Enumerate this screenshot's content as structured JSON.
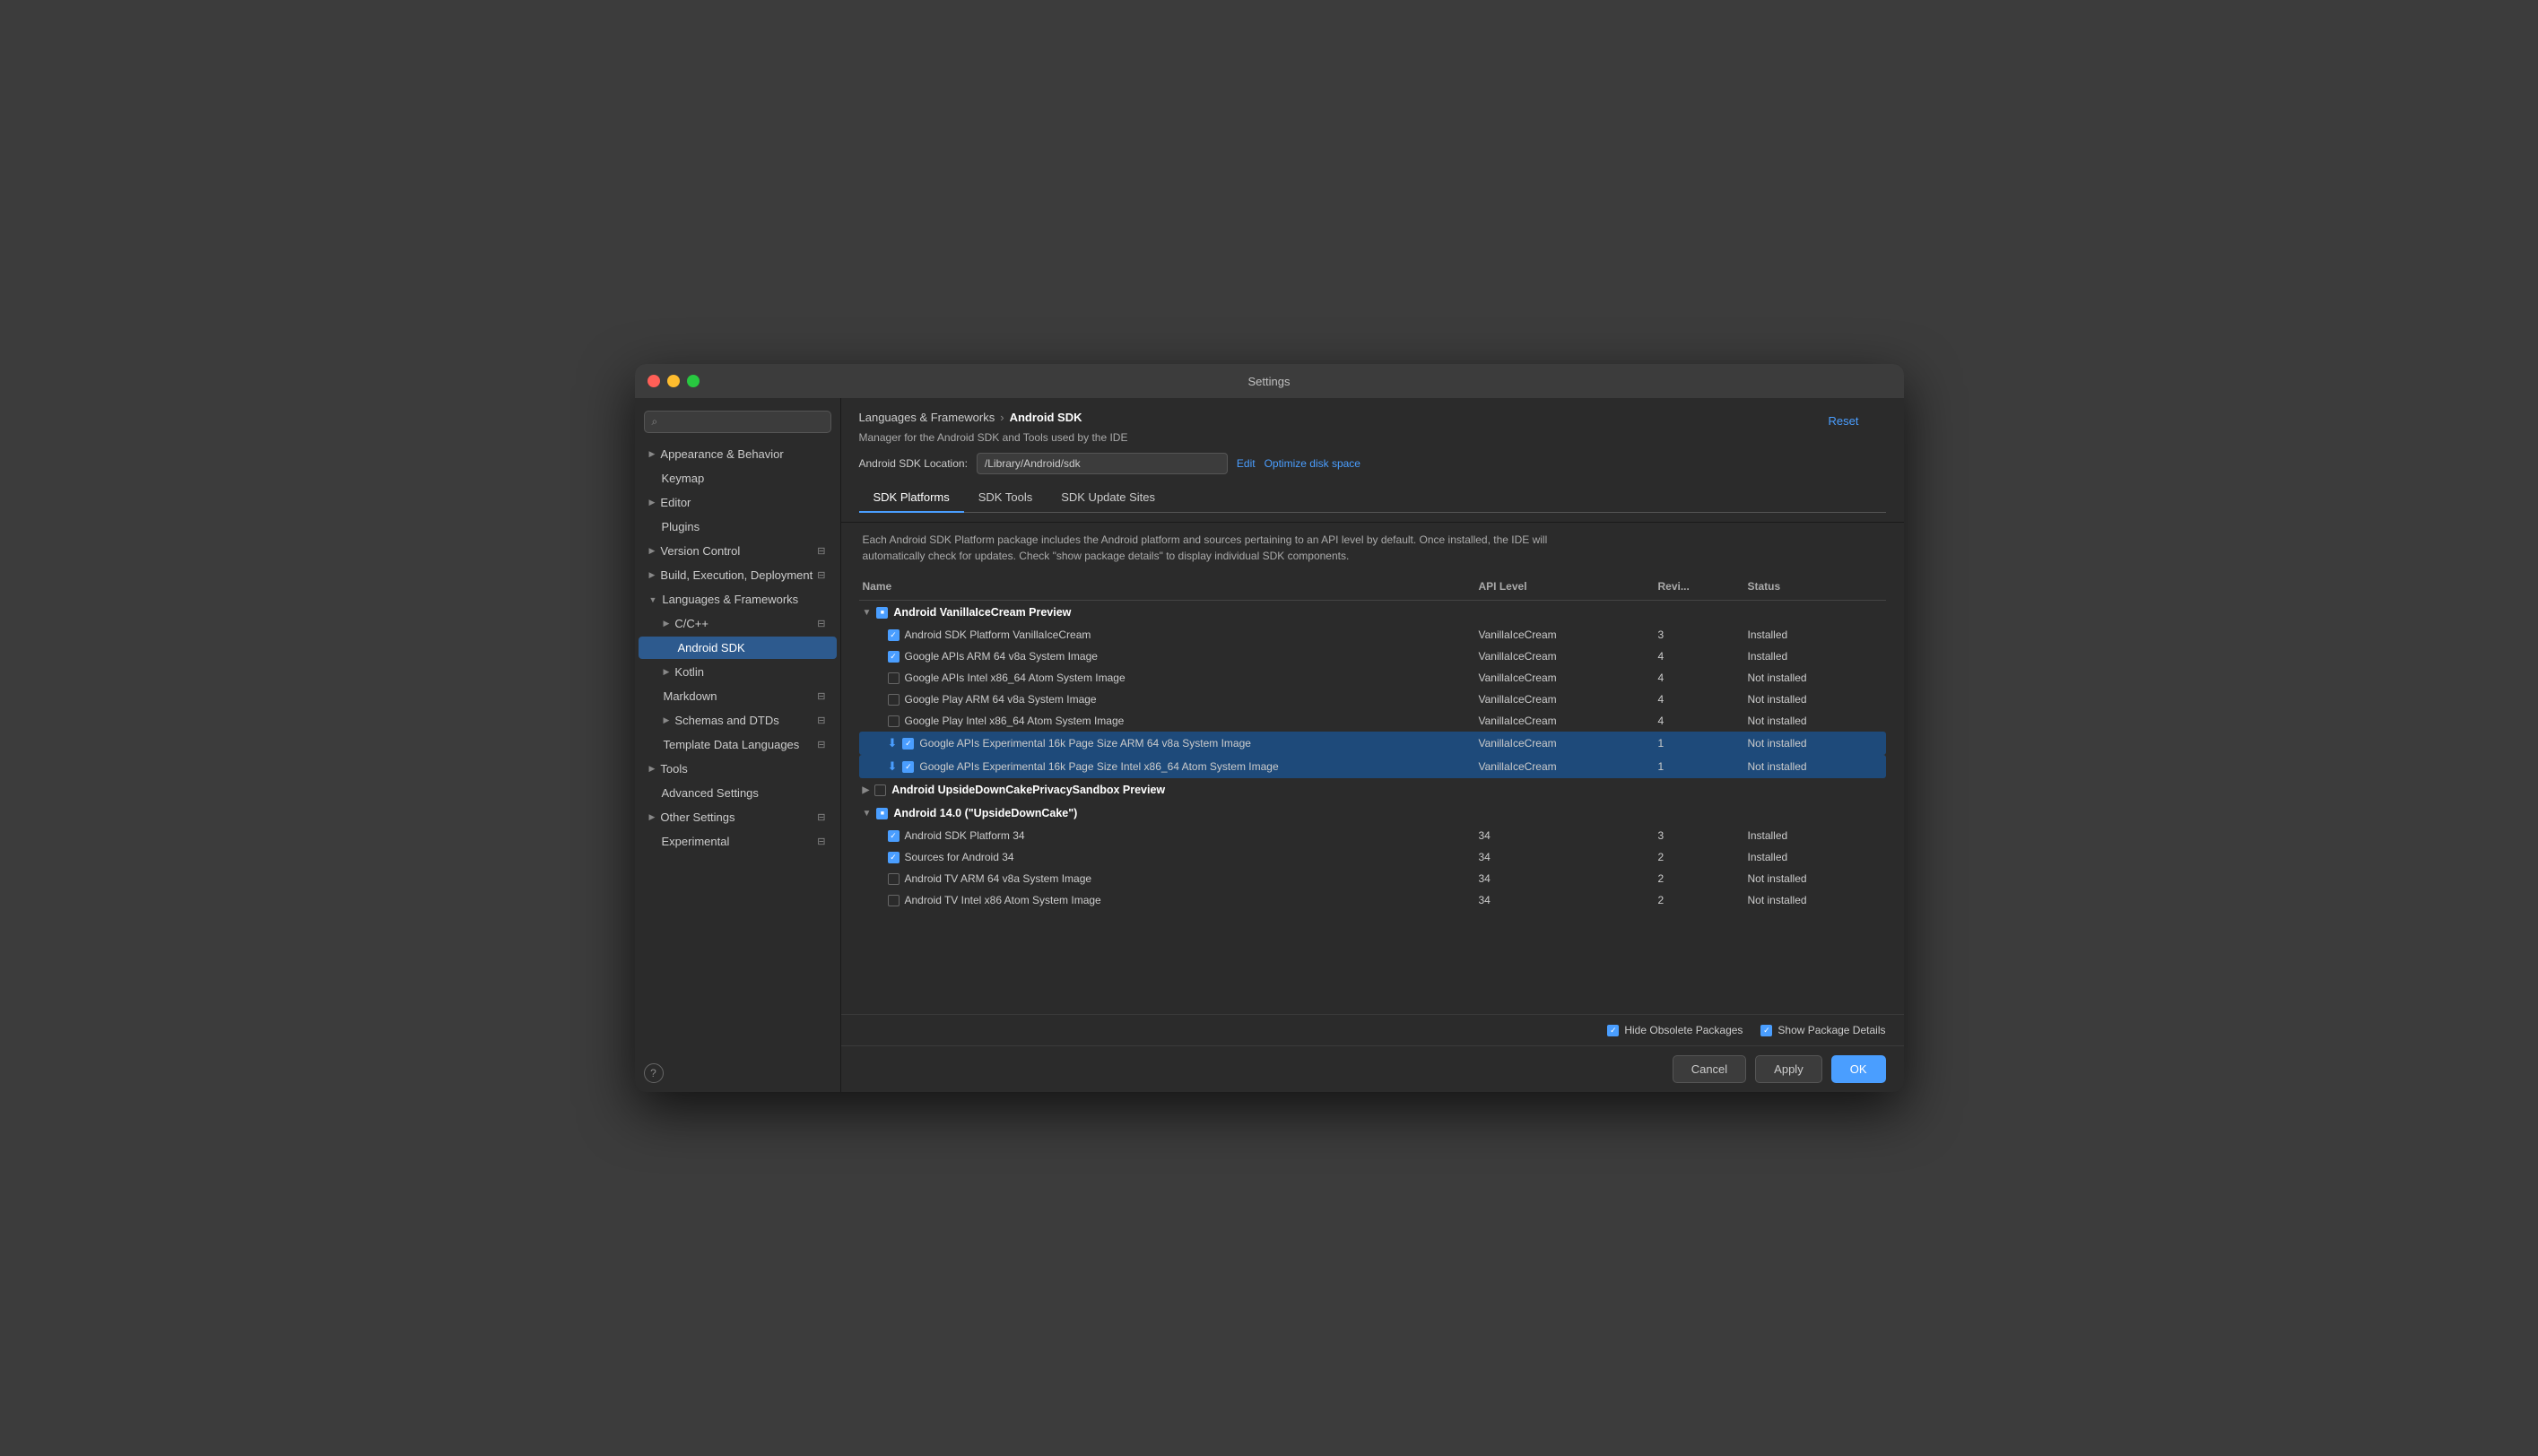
{
  "window": {
    "title": "Settings"
  },
  "sidebar": {
    "search_placeholder": "🔍",
    "items": [
      {
        "id": "appearance",
        "label": "Appearance & Behavior",
        "level": 0,
        "has_chevron": true,
        "chevron": "▶",
        "active": false
      },
      {
        "id": "keymap",
        "label": "Keymap",
        "level": 0,
        "active": false
      },
      {
        "id": "editor",
        "label": "Editor",
        "level": 0,
        "has_chevron": true,
        "chevron": "▶",
        "active": false
      },
      {
        "id": "plugins",
        "label": "Plugins",
        "level": 0,
        "active": false
      },
      {
        "id": "version-control",
        "label": "Version Control",
        "level": 0,
        "has_chevron": true,
        "chevron": "▶",
        "active": false,
        "has_icon": true
      },
      {
        "id": "build-execution",
        "label": "Build, Execution, Deployment",
        "level": 0,
        "has_chevron": true,
        "chevron": "▶",
        "active": false,
        "has_icon": true
      },
      {
        "id": "languages-frameworks",
        "label": "Languages & Frameworks",
        "level": 0,
        "has_chevron": true,
        "chevron": "▼",
        "active": false
      },
      {
        "id": "cpp",
        "label": "C/C++",
        "level": 1,
        "has_chevron": true,
        "chevron": "▶",
        "active": false,
        "has_icon": true
      },
      {
        "id": "android-sdk",
        "label": "Android SDK",
        "level": 2,
        "active": true
      },
      {
        "id": "kotlin",
        "label": "Kotlin",
        "level": 1,
        "has_chevron": true,
        "chevron": "▶",
        "active": false
      },
      {
        "id": "markdown",
        "label": "Markdown",
        "level": 1,
        "active": false,
        "has_icon": true
      },
      {
        "id": "schemas-dtds",
        "label": "Schemas and DTDs",
        "level": 1,
        "has_chevron": true,
        "chevron": "▶",
        "active": false,
        "has_icon": true
      },
      {
        "id": "template-data",
        "label": "Template Data Languages",
        "level": 1,
        "active": false,
        "has_icon": true
      },
      {
        "id": "tools",
        "label": "Tools",
        "level": 0,
        "has_chevron": true,
        "chevron": "▶",
        "active": false
      },
      {
        "id": "advanced-settings",
        "label": "Advanced Settings",
        "level": 0,
        "active": false
      },
      {
        "id": "other-settings",
        "label": "Other Settings",
        "level": 0,
        "has_chevron": true,
        "chevron": "▶",
        "active": false,
        "has_icon": true
      },
      {
        "id": "experimental",
        "label": "Experimental",
        "level": 0,
        "active": false,
        "has_icon": true
      }
    ]
  },
  "content": {
    "breadcrumb": {
      "parent": "Languages & Frameworks",
      "separator": "›",
      "current": "Android SDK"
    },
    "reset_label": "Reset",
    "description": "Manager for the Android SDK and Tools used by the IDE",
    "location_label": "Android SDK Location:",
    "location_value": "/Library/Android/sdk",
    "edit_label": "Edit",
    "optimize_label": "Optimize disk space",
    "tabs": [
      {
        "id": "sdk-platforms",
        "label": "SDK Platforms",
        "active": true
      },
      {
        "id": "sdk-tools",
        "label": "SDK Tools",
        "active": false
      },
      {
        "id": "sdk-update-sites",
        "label": "SDK Update Sites",
        "active": false
      }
    ],
    "info_text": "Each Android SDK Platform package includes the Android platform and sources pertaining to an API level by default. Once installed, the IDE will automatically check for updates. Check \"show package details\" to display individual SDK components.",
    "table": {
      "headers": [
        "Name",
        "API Level",
        "Revi...",
        "Status"
      ],
      "groups": [
        {
          "id": "vanilla-ice-cream",
          "name": "Android VanillaIceCream Preview",
          "expanded": true,
          "checkbox": "indeterminate",
          "items": [
            {
              "name": "Android SDK Platform VanillaIceCream",
              "api": "VanillaIceCream",
              "rev": "3",
              "status": "Installed",
              "checked": true,
              "download": false,
              "highlighted": false
            },
            {
              "name": "Google APIs ARM 64 v8a System Image",
              "api": "VanillaIceCream",
              "rev": "4",
              "status": "Installed",
              "checked": true,
              "download": false,
              "highlighted": false
            },
            {
              "name": "Google APIs Intel x86_64 Atom System Image",
              "api": "VanillaIceCream",
              "rev": "4",
              "status": "Not installed",
              "checked": false,
              "download": false,
              "highlighted": false
            },
            {
              "name": "Google Play ARM 64 v8a System Image",
              "api": "VanillaIceCream",
              "rev": "4",
              "status": "Not installed",
              "checked": false,
              "download": false,
              "highlighted": false
            },
            {
              "name": "Google Play Intel x86_64 Atom System Image",
              "api": "VanillaIceCream",
              "rev": "4",
              "status": "Not installed",
              "checked": false,
              "download": false,
              "highlighted": false
            },
            {
              "name": "Google APIs Experimental 16k Page Size ARM 64 v8a System Image",
              "api": "VanillaIceCream",
              "rev": "1",
              "status": "Not installed",
              "checked": true,
              "download": true,
              "highlighted": true
            },
            {
              "name": "Google APIs Experimental 16k Page Size Intel x86_64 Atom System Image",
              "api": "VanillaIceCream",
              "rev": "1",
              "status": "Not installed",
              "checked": true,
              "download": true,
              "highlighted": true
            }
          ]
        },
        {
          "id": "upside-down-sandbox",
          "name": "Android UpsideDownCakePrivacySandbox Preview",
          "expanded": false,
          "checkbox": "unchecked",
          "items": []
        },
        {
          "id": "android-14",
          "name": "Android 14.0 (\"UpsideDownCake\")",
          "expanded": true,
          "checkbox": "indeterminate",
          "items": [
            {
              "name": "Android SDK Platform 34",
              "api": "34",
              "rev": "3",
              "status": "Installed",
              "checked": true,
              "download": false,
              "highlighted": false
            },
            {
              "name": "Sources for Android 34",
              "api": "34",
              "rev": "2",
              "status": "Installed",
              "checked": true,
              "download": false,
              "highlighted": false
            },
            {
              "name": "Android TV ARM 64 v8a System Image",
              "api": "34",
              "rev": "2",
              "status": "Not installed",
              "checked": false,
              "download": false,
              "highlighted": false
            },
            {
              "name": "Android TV Intel x86 Atom System Image",
              "api": "34",
              "rev": "2",
              "status": "Not installed",
              "checked": false,
              "download": false,
              "highlighted": false
            }
          ]
        }
      ]
    },
    "footer": {
      "hide_obsolete": true,
      "hide_obsolete_label": "Hide Obsolete Packages",
      "show_package": true,
      "show_package_label": "Show Package Details"
    },
    "buttons": {
      "cancel": "Cancel",
      "apply": "Apply",
      "ok": "OK"
    }
  }
}
